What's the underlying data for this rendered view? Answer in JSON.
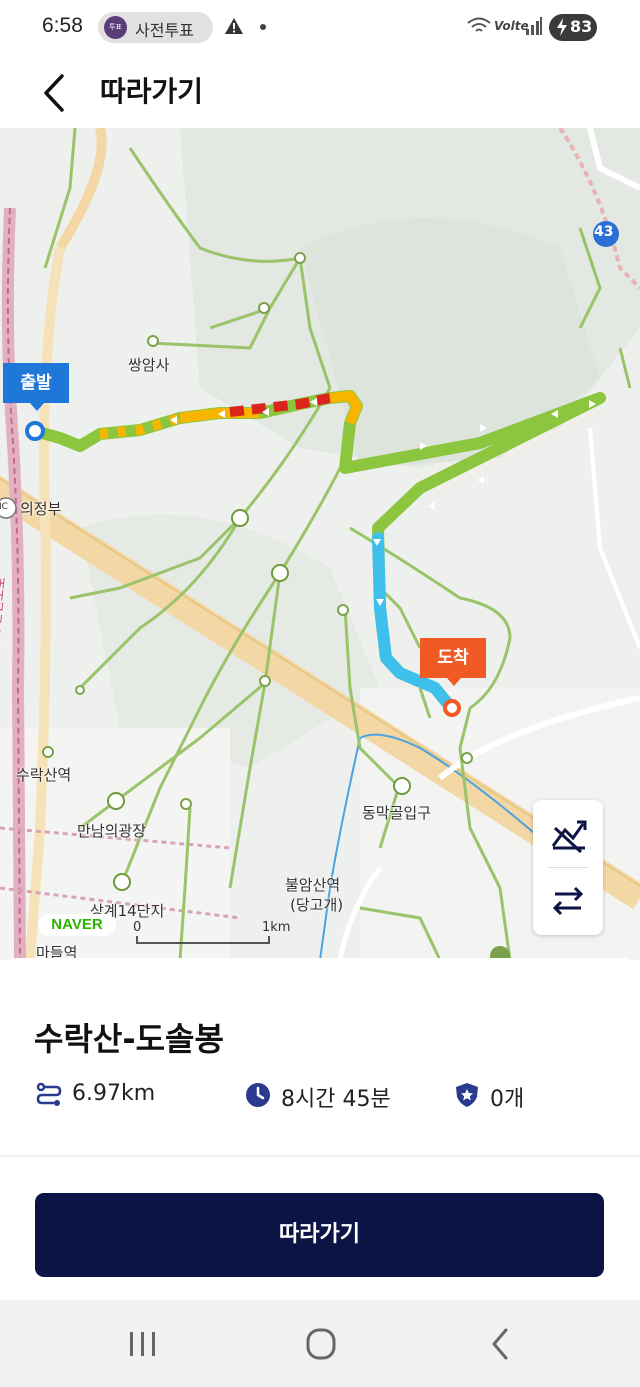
{
  "status": {
    "time": "6:58",
    "pill_text": "사전투표",
    "pill_logo": "투표",
    "network": "Volte",
    "battery": "83"
  },
  "appbar": {
    "title": "따라가기",
    "back_icon": "back-arrow-icon"
  },
  "map": {
    "start_flag": "출발",
    "end_flag": "도착",
    "road_badge": "43",
    "ic_badge": "IC",
    "naver_logo": "NAVER",
    "scale_start": "0",
    "scale_end": "1km",
    "labels": {
      "ssangamsa": "쌍암사",
      "uijeongbu": "의정부",
      "suraksan_station": "수락산역",
      "mannam_plaza": "만남의광장",
      "sanggye": "상계14단지",
      "madeul": "마들역",
      "bulamsan_station": "불암산역",
      "danggogae": "(당고개)",
      "dongmakgol": "동막골입구",
      "road_vertical": "동부간선도로"
    },
    "track_colors": {
      "easy": "#8cc63f",
      "medium": "#f7b500",
      "hard": "#d9251c",
      "selected": "#3fc0ec",
      "trail": "#9ac36a"
    }
  },
  "route": {
    "title": "수락산-도솔봉",
    "distance": "6.97km",
    "duration": "8시간 45분",
    "badges": "0개"
  },
  "actions": {
    "follow_label": "따라가기"
  }
}
